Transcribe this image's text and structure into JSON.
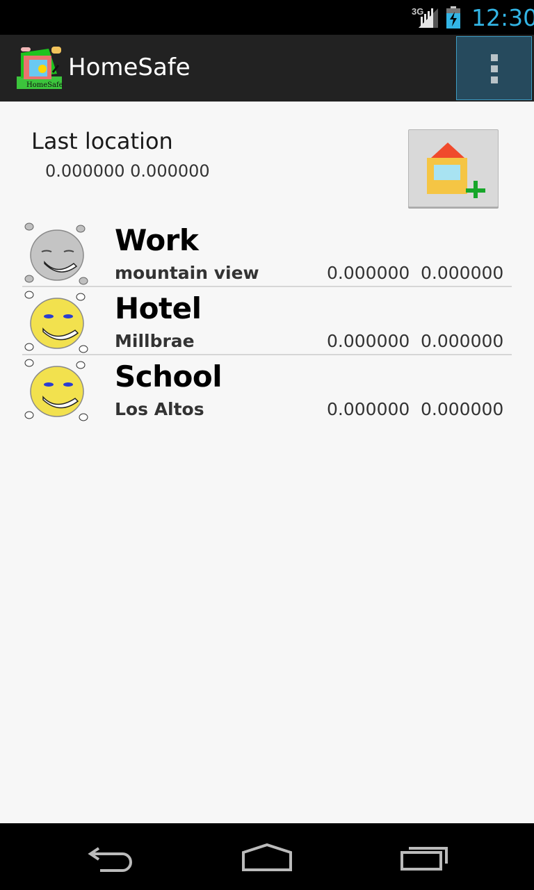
{
  "status_bar": {
    "network": "3G",
    "time": "12:30",
    "icons": [
      "signal-icon",
      "battery-charging-icon"
    ],
    "time_color": "#33b5e5"
  },
  "action_bar": {
    "title": "HomeSafe",
    "icon_label": "HomeSafe",
    "overflow_icon": "overflow-menu-icon",
    "background": "#222222"
  },
  "last_location": {
    "label": "Last location",
    "coords": "0.000000 0.000000",
    "add_button_icon": "add-home-icon"
  },
  "places": [
    {
      "name": "Work",
      "place": "mountain view",
      "lat": "0.000000",
      "lon": "0.000000",
      "icon": "gray-face-icon"
    },
    {
      "name": "Hotel",
      "place": "Millbrae",
      "lat": "0.000000",
      "lon": "0.000000",
      "icon": "yellow-face-icon"
    },
    {
      "name": "School",
      "place": "Los Altos",
      "lat": "0.000000",
      "lon": "0.000000",
      "icon": "yellow-face-icon"
    }
  ],
  "nav_bar": {
    "icons": [
      "back-icon",
      "home-icon",
      "recents-icon"
    ]
  }
}
